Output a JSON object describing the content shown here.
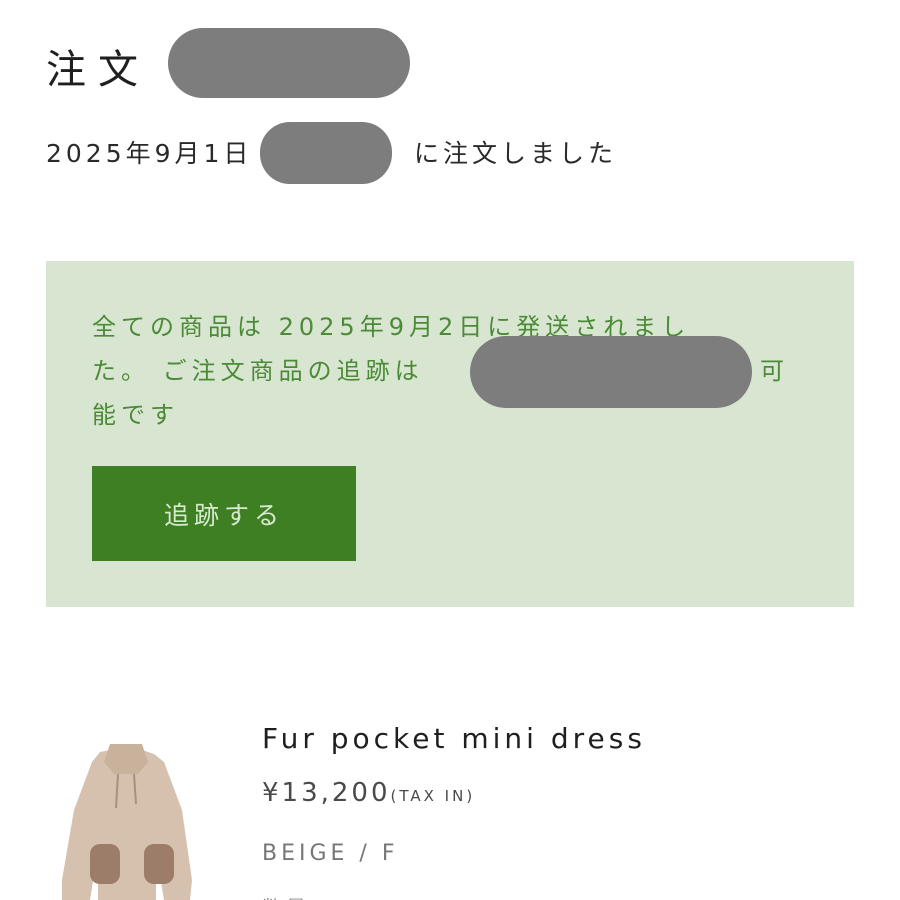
{
  "order": {
    "heading": "注文 #",
    "date_prefix": "2025年9月1日",
    "date_suffix": "に注文しました"
  },
  "shipping_status": {
    "line1": "全ての商品は 2025年9月2日に発送されまし",
    "line2": "た。 ご注文商品の追跡は",
    "line2_tail": "可",
    "line3": "能です",
    "track_button_label": "追跡する"
  },
  "product": {
    "name": "Fur pocket mini dress",
    "price": "¥13,200",
    "tax_note": "(TAX IN)",
    "variant": "BEIGE / F",
    "quantity_label": "数量"
  },
  "colors": {
    "status_background": "#d8e6d1",
    "status_text": "#4b8a36",
    "button_background": "#3f7f24"
  }
}
